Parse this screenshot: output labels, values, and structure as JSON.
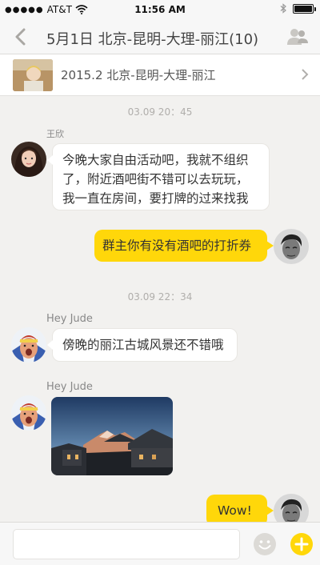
{
  "status_bar": {
    "carrier": "AT&T",
    "time": "11:56 AM"
  },
  "nav": {
    "title": "5月1日 北京-昆明-大理-丽江(10)"
  },
  "trip_card": {
    "label": "2015.2 北京-昆明-大理-丽江"
  },
  "messages": {
    "ts1": "03.09 20：45",
    "sender1": "王欣",
    "text1_line1": "今晚大家自由活动吧，我就不组织",
    "text1_line2": "了，附近酒吧街不错可以去玩玩，",
    "text1_line3": "我一直在房间，要打牌的过来找我",
    "out1": "群主你有没有酒吧的打折券",
    "ts2": "03.09 22：34",
    "sender2": "Hey Jude",
    "text2": "傍晚的丽江古城风景还不错哦",
    "sender3": "Hey Jude",
    "out2": "Wow!"
  },
  "input": {
    "placeholder": ""
  },
  "colors": {
    "accent": "#ffd70a",
    "background": "#f2f1ef"
  }
}
